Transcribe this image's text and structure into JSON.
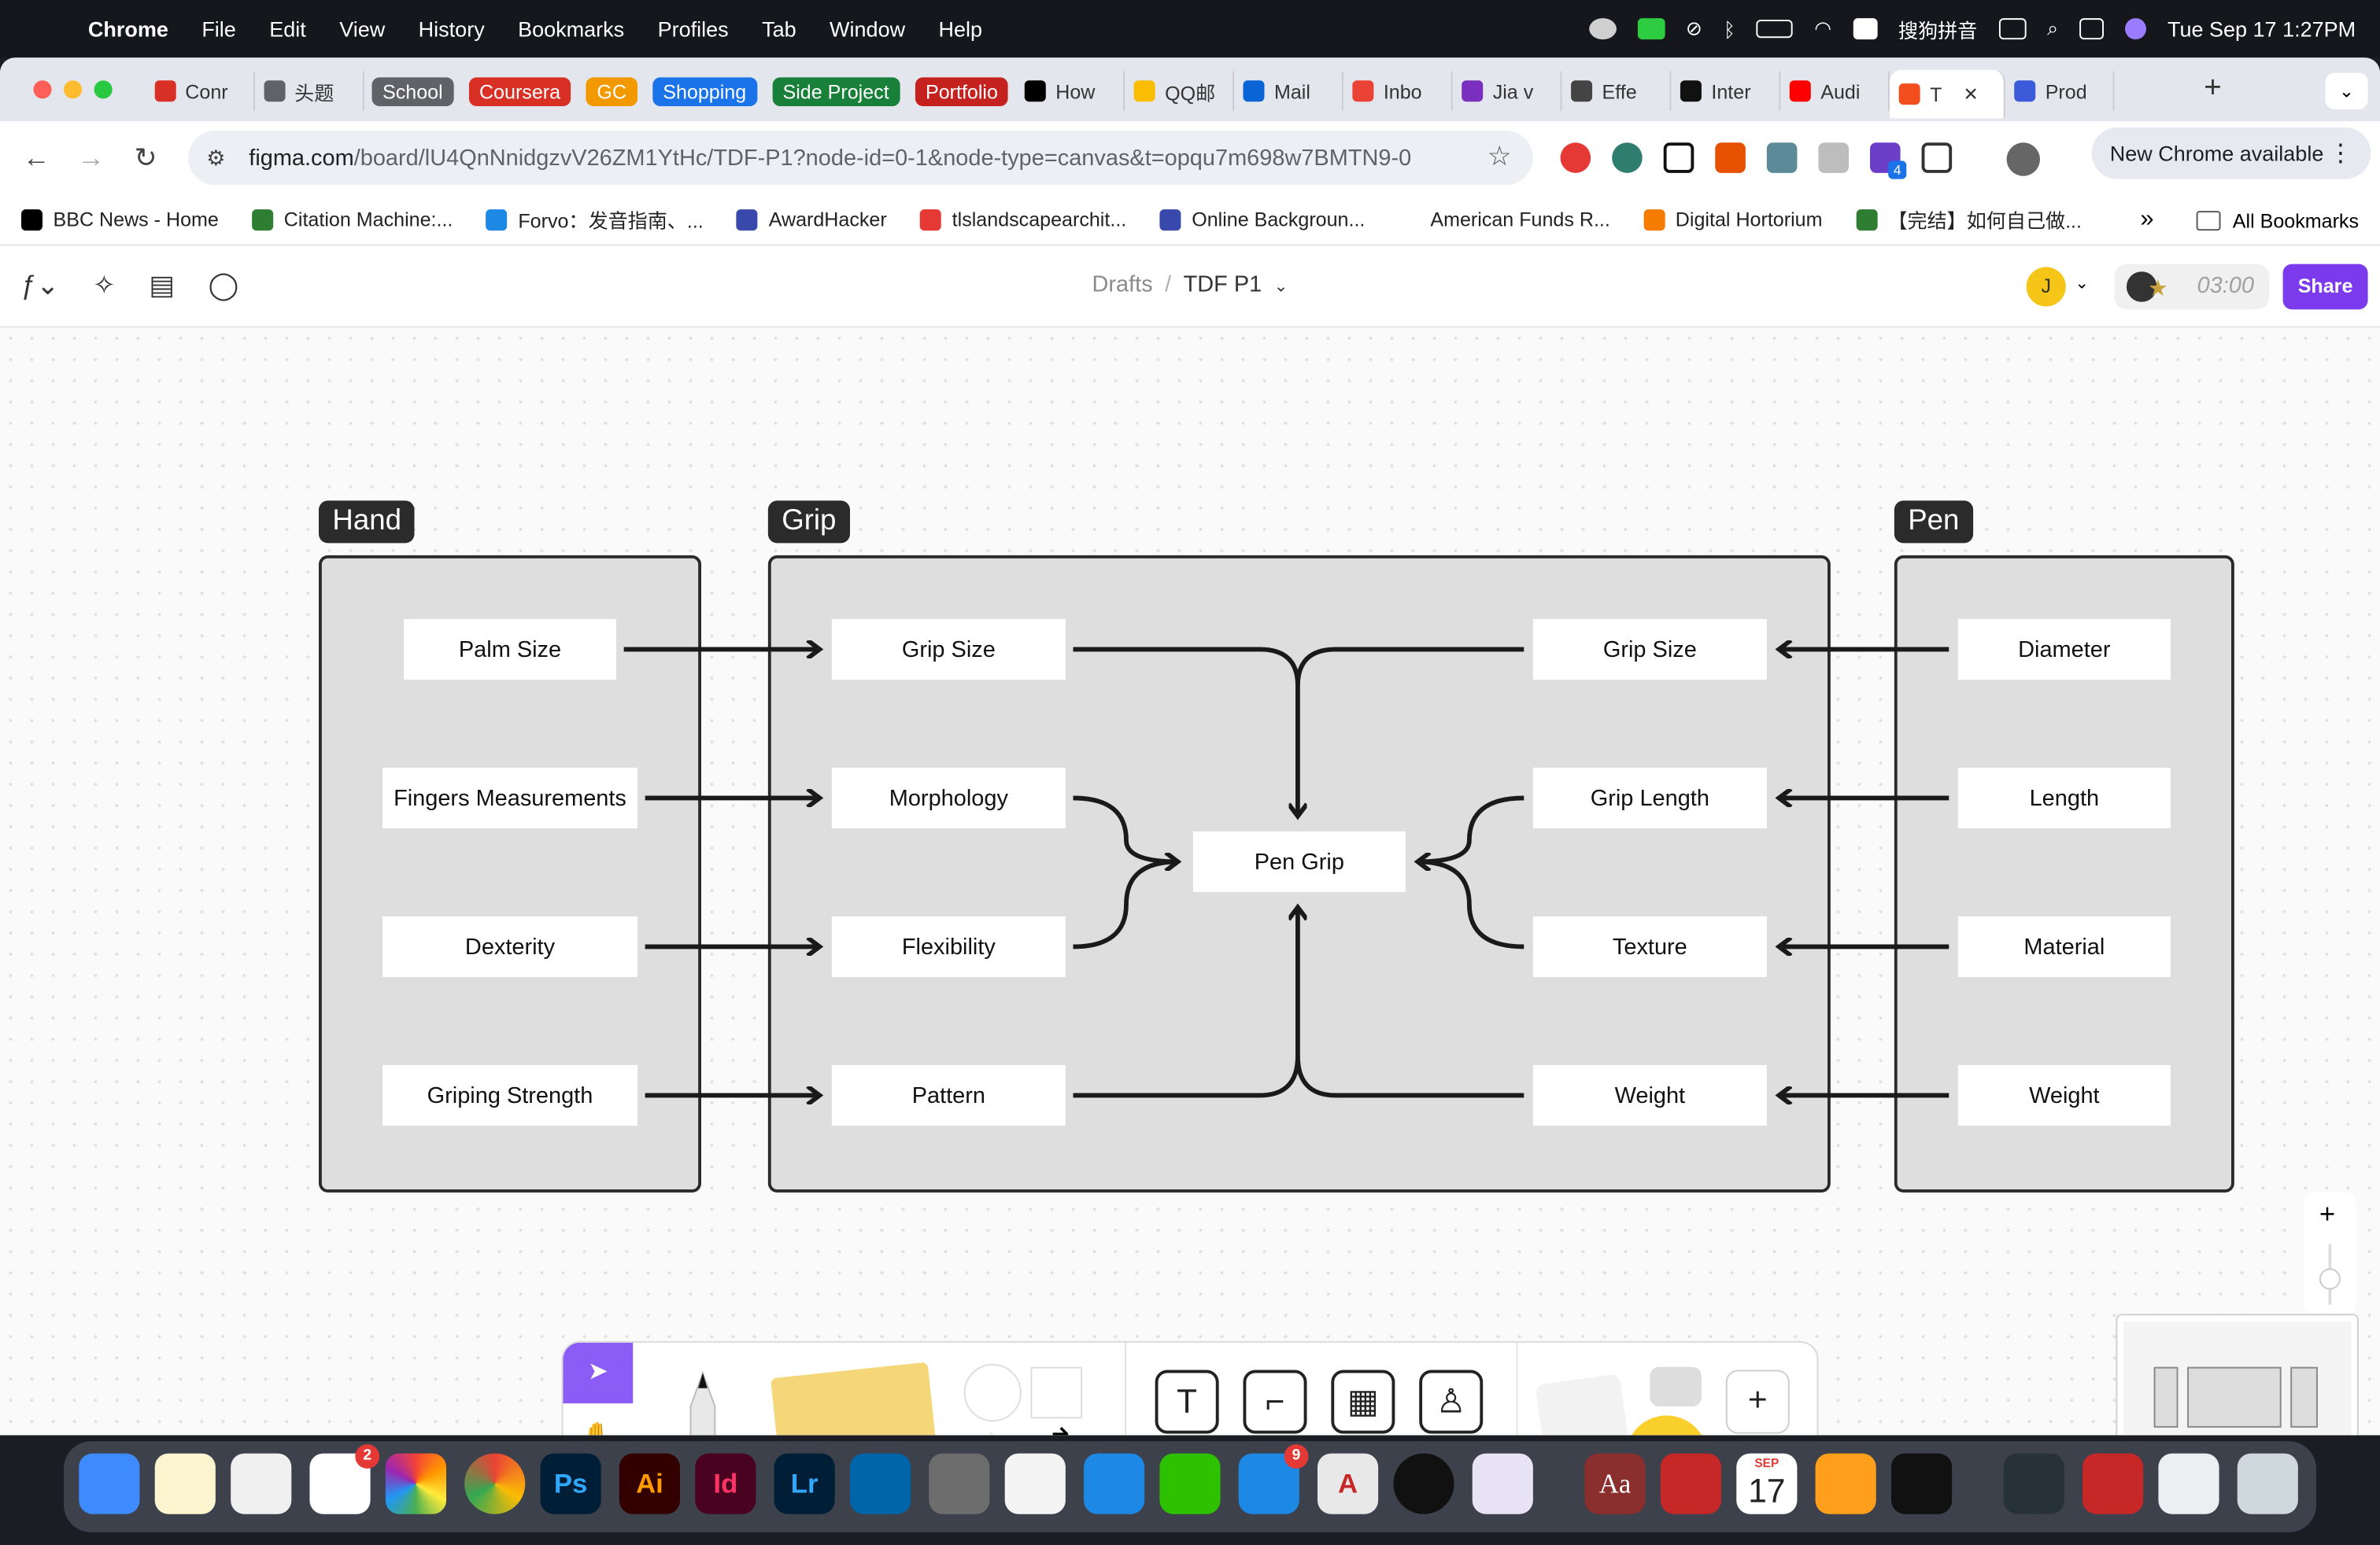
{
  "menubar": {
    "app": "Chrome",
    "items": [
      "File",
      "Edit",
      "View",
      "History",
      "Bookmarks",
      "Profiles",
      "Tab",
      "Window",
      "Help"
    ],
    "ime": "搜狗拼音",
    "datetime": "Tue Sep 17  1:27PM"
  },
  "tabs": [
    {
      "label": "Conr",
      "type": "tab",
      "color": "#d93025"
    },
    {
      "label": "头题",
      "type": "tab",
      "color": "#5f6368"
    },
    {
      "label": "School",
      "type": "group",
      "color": "#5f6368"
    },
    {
      "label": "Coursera",
      "type": "group",
      "color": "#d93025"
    },
    {
      "label": "GC",
      "type": "group",
      "color": "#f29900"
    },
    {
      "label": "Shopping",
      "type": "group",
      "color": "#1a73e8"
    },
    {
      "label": "Side Project",
      "type": "group",
      "color": "#188038"
    },
    {
      "label": "Portfolio",
      "type": "group",
      "color": "#c5221f"
    },
    {
      "label": "How",
      "type": "tab",
      "color": "#000000"
    },
    {
      "label": "QQ邮",
      "type": "tab",
      "color": "#fbbc04"
    },
    {
      "label": "Mail",
      "type": "tab",
      "color": "#0a64d6"
    },
    {
      "label": "Inbo",
      "type": "tab",
      "color": "#ea4335"
    },
    {
      "label": "Jia v",
      "type": "tab",
      "color": "#7b2fbe"
    },
    {
      "label": "Effe",
      "type": "tab",
      "color": "#444444"
    },
    {
      "label": "Inter",
      "type": "tab",
      "color": "#111111"
    },
    {
      "label": "Audi",
      "type": "tab",
      "color": "#ff0000"
    },
    {
      "label": "T",
      "type": "active",
      "color": "#f24e1e"
    },
    {
      "label": "Prod",
      "type": "tab",
      "color": "#3b5bdb"
    }
  ],
  "toolbar": {
    "url_host": "figma.com",
    "url_path": "/board/lU4QnNnidgzvV26ZM1YtHc/TDF-P1?node-id=0-1&node-type=canvas&t=opqu7m698w7BMTN9-0",
    "new_chrome": "New Chrome available",
    "ext_badge": "4"
  },
  "bookmarks": [
    {
      "label": "BBC News - Home",
      "color": "#000000"
    },
    {
      "label": "Citation Machine:...",
      "color": "#2e7d32"
    },
    {
      "label": "Forvo：发音指南、...",
      "color": "#1e88e5"
    },
    {
      "label": "AwardHacker",
      "color": "#3949ab"
    },
    {
      "label": "tlslandscapearchit...",
      "color": "#e53935"
    },
    {
      "label": "Online Backgroun...",
      "color": "#3949ab"
    },
    {
      "label": "American Funds R...",
      "color": "#ffffff"
    },
    {
      "label": "Digital Hortorium",
      "color": "#f57c00"
    },
    {
      "label": "【完结】如何自己做...",
      "color": "#2e7d32"
    }
  ],
  "bookmarks_right": {
    "more": "»",
    "all": "All Bookmarks"
  },
  "figjam": {
    "breadcrumb_root": "Drafts",
    "file_name": "TDF P1",
    "avatar_initial": "J",
    "timer": "03:00",
    "share_label": "Share"
  },
  "diagram": {
    "hand": {
      "label": "Hand",
      "items": [
        "Palm Size",
        "Fingers Measurements",
        "Dexterity",
        "Griping Strength"
      ]
    },
    "grip": {
      "label": "Grip",
      "left_items": [
        "Grip Size",
        "Morphology",
        "Flexibility",
        "Pattern"
      ],
      "right_items": [
        "Grip Size",
        "Grip Length",
        "Texture",
        "Weight"
      ],
      "center": "Pen Grip"
    },
    "pen": {
      "label": "Pen",
      "items": [
        "Diameter",
        "Length",
        "Material",
        "Weight"
      ]
    }
  },
  "dock": {
    "reminders_badge": "2",
    "appstore_badge": "9",
    "calendar_month": "SEP",
    "calendar_day": "17"
  },
  "accent": "#7c3aed"
}
